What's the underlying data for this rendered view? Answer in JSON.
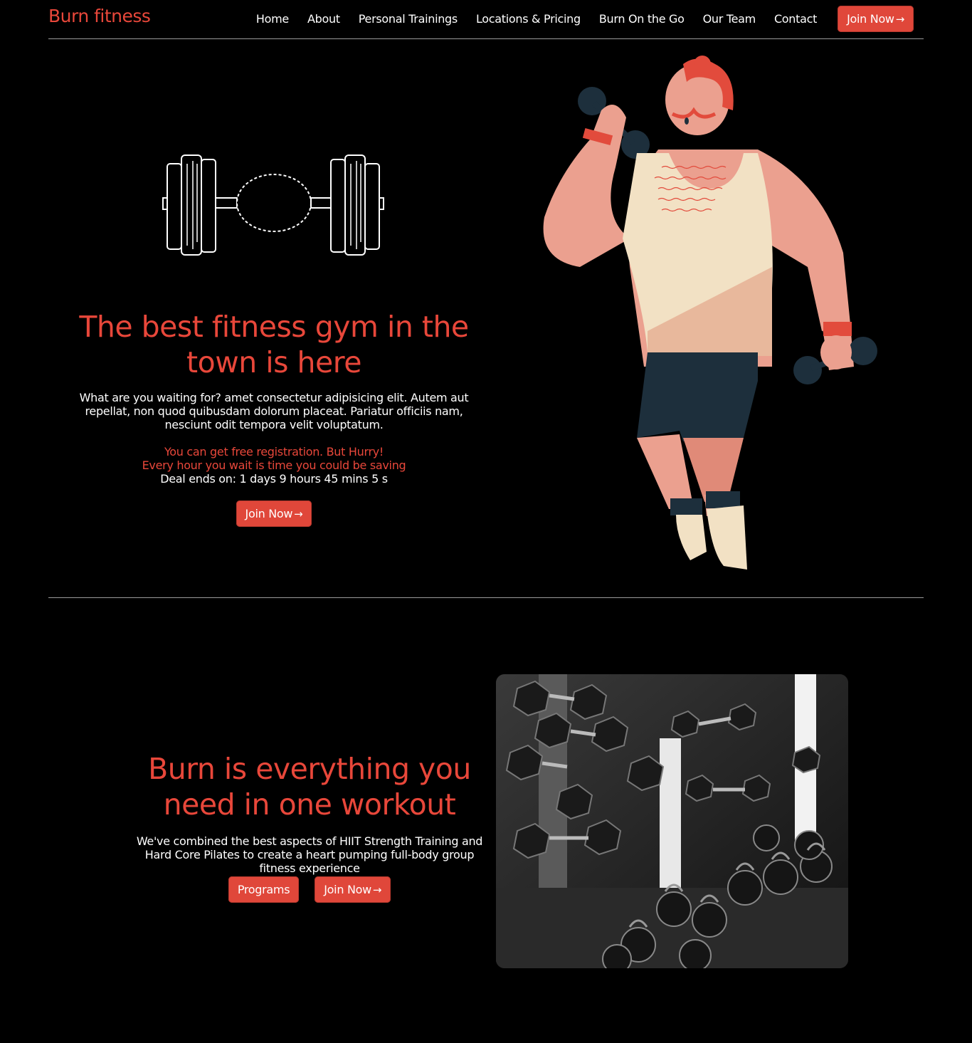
{
  "brand": {
    "name": "Burn fitness",
    "accent": "#e8473a"
  },
  "nav": {
    "items": [
      {
        "label": "Home"
      },
      {
        "label": "About"
      },
      {
        "label": "Personal Trainings"
      },
      {
        "label": "Locations & Pricing"
      },
      {
        "label": "Burn On the Go"
      },
      {
        "label": "Our Team"
      },
      {
        "label": "Contact"
      }
    ],
    "cta_label": "Join Now",
    "cta_icon": "arrow-right-icon"
  },
  "hero": {
    "title": "The best fitness gym in the town is here",
    "text": "What are you waiting for? amet consectetur adipisicing elit. Autem aut repellat, non quod quibusdam dolorum placeat. Pariatur officiis nam, nesciunt odit tempora velit voluptatum.",
    "promo_line1": "You can get free registration. But Hurry!",
    "promo_line2": "Every hour you wait is time you could be saving",
    "countdown": "Deal ends on: 1 days 9 hours 45 mins 5 s",
    "cta_label": "Join Now"
  },
  "section2": {
    "title": "Burn is everything you need in one workout",
    "text": "We've combined the best aspects of HIIT Strength Training and Hard Core Pilates to create a heart pumping full-body group fitness experience",
    "programs_label": "Programs",
    "cta_label": "Join Now"
  }
}
